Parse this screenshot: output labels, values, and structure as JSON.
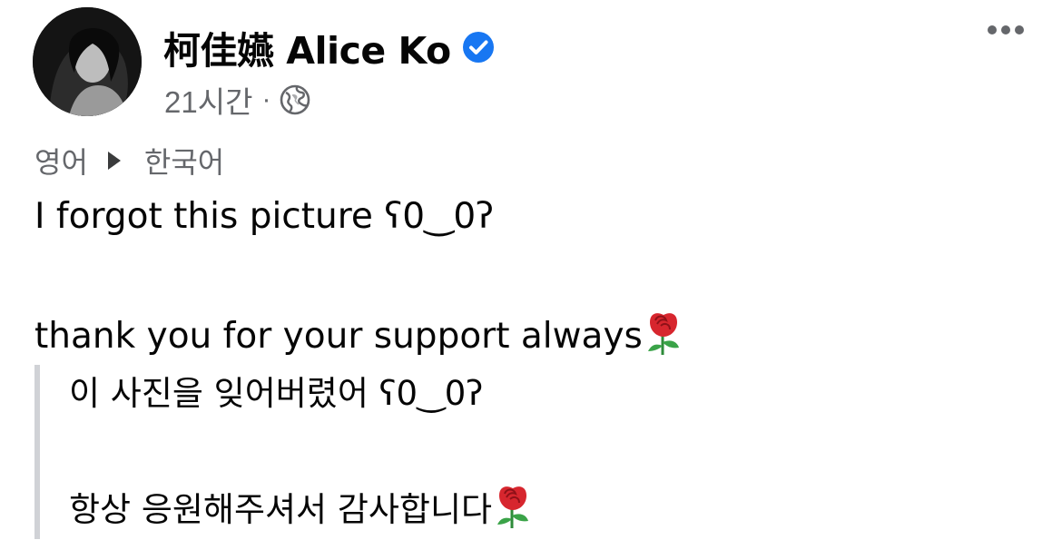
{
  "post": {
    "author_name": "柯佳嬿 Alice Ko",
    "verified": true,
    "timestamp": "21시간",
    "separator": "·",
    "audience_icon": "globe-icon"
  },
  "translation": {
    "source_language": "영어",
    "target_language": "한국어"
  },
  "content": {
    "line1": "I forgot this picture ʕ0‿0ʔ",
    "line2": "thank you for your support always",
    "emoji": "rose"
  },
  "translated_content": {
    "line1": "이 사진을 잊어버렸어 ʕ0‿0ʔ",
    "line2": "항상 응원해주셔서 감사합니다"
  },
  "colors": {
    "verified_badge": "#1877f2",
    "secondary_text": "#65676b",
    "quote_bar": "#d0d2d6",
    "rose": "#d7262e"
  }
}
